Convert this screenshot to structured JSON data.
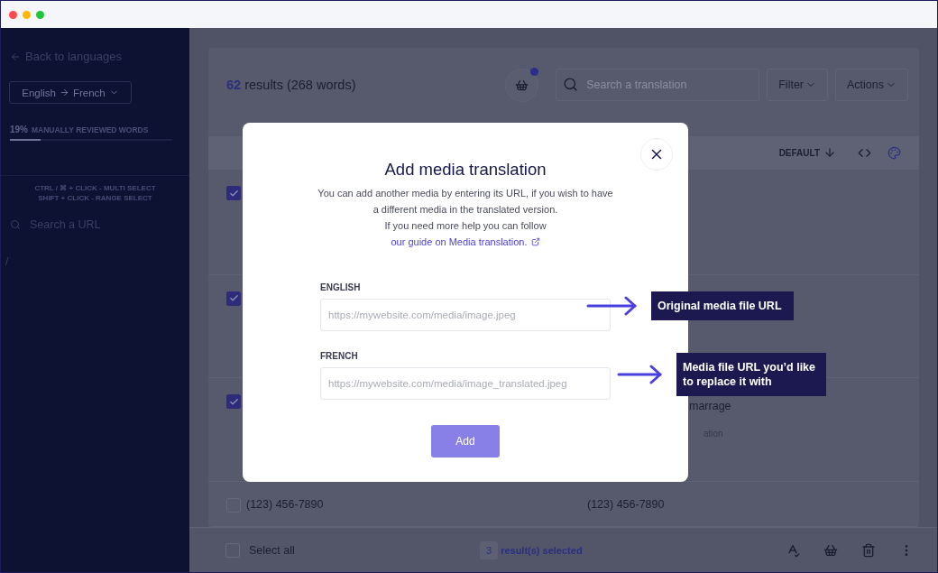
{
  "sidebar": {
    "back_link": "Back to languages",
    "language_selector": {
      "source": "English",
      "target": "French"
    },
    "progress": {
      "percent": "19%",
      "label": "MANUALLY REVIEWED WORDS",
      "level": 0.19
    },
    "hints": [
      "CTRL / ⌘ + CLICK - MULTI SELECT",
      "SHIFT + CLICK - RANGE SELECT"
    ],
    "search": {
      "placeholder": "Search a URL"
    },
    "pages": [
      {
        "path": "/"
      }
    ]
  },
  "toolbar": {
    "count": "62",
    "count_text": "results (268 words)",
    "basket_has_items": true,
    "search": {
      "placeholder": "Search a translation"
    },
    "filter": "Filter",
    "actions": "Actions"
  },
  "table": {
    "sort_label": "DEFAULT",
    "rows": [
      {
        "checked": true
      },
      {
        "checked": true
      },
      {
        "checked": true,
        "translation": "marrage",
        "note": "ation",
        "clipped_by_dialog": true
      },
      {
        "checked": false,
        "source": "(123) 456-7890",
        "translation": "(123) 456-7890"
      }
    ]
  },
  "footer": {
    "select_all": {
      "label": "Select all",
      "checked": false
    },
    "selected_count": "3",
    "selected_text": "result(s) selected"
  },
  "modal": {
    "title": "Add media translation",
    "description": "You can add another media by entering its URL, if you wish to have a different media in the translated version.",
    "help_text": "If you need more help you can follow",
    "link_text": "our guide on Media translation.",
    "fields": [
      {
        "label": "ENGLISH",
        "placeholder": "https://mywebsite.com/media/image.jpeg"
      },
      {
        "label": "FRENCH",
        "placeholder": "https://mywebsite.com/media/image_translated.jpeg"
      }
    ],
    "button": "Add"
  },
  "annotations": [
    {
      "text": "Original media file URL"
    },
    {
      "text": "Media file URL you’d like to replace it with"
    }
  ]
}
